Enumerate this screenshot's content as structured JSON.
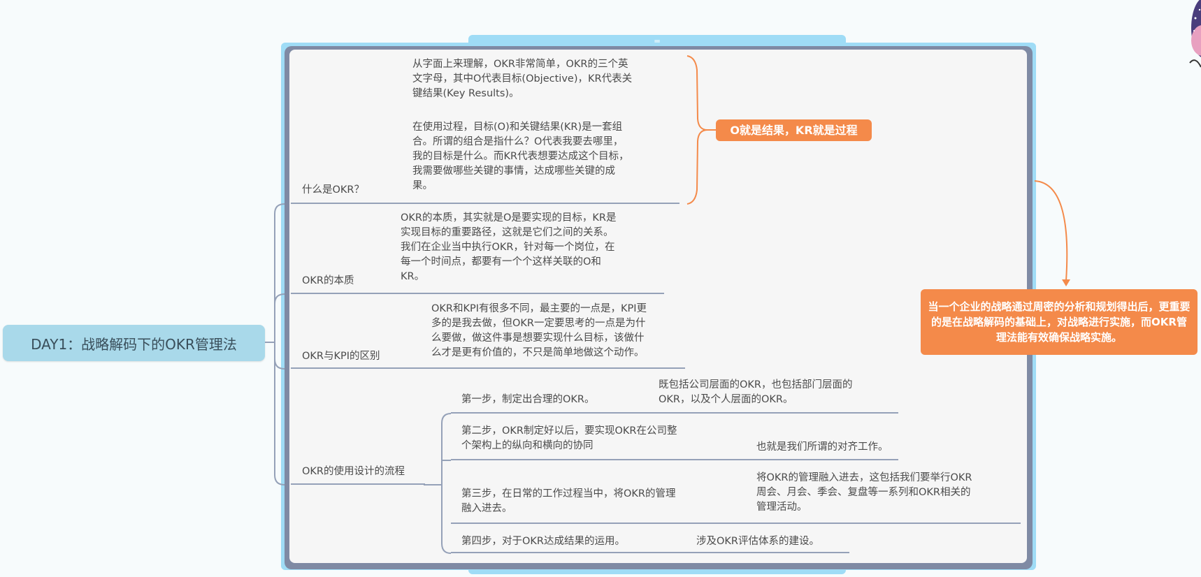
{
  "root": {
    "label": "DAY1：战略解码下的OKR管理法"
  },
  "frame": {
    "top_handle": "═",
    "bottom_handle": "═"
  },
  "branches": [
    {
      "label": "什么是OKR？",
      "detail_1": "从字面上来理解，OKR非常简单，OKR的三个英\n文字母，其中O代表目标(Objective)，KR代表关\n键结果(Key Results)。",
      "detail_2": "在使用过程，目标(O)和关键结果(KR)是一套组\n合。所谓的组合是指什么？O代表我要去哪里，\n我的目标是什么。而KR代表想要达成这个目标，\n我需要做哪些关键的事情，达成哪些关键的成\n果。"
    },
    {
      "label": "OKR的本质",
      "detail": "OKR的本质，其实就是O是要实现的目标，KR是\n实现目标的重要路径，这就是它们之间的关系。\n我们在企业当中执行OKR，针对每一个岗位，在\n每一个时间点，都要有一个个这样关联的O和\nKR。"
    },
    {
      "label": "OKR与KPI的区别",
      "detail": "OKR和KPI有很多不同，最主要的一点是，KPI更\n多的是我去做，但OKR一定要思考的一点是为什\n么要做，做这件事是想要实现什么目标，该做什\n么才是更有价值的，不只是简单地做这个动作。"
    },
    {
      "label": "OKR的使用设计的流程",
      "steps": [
        {
          "label": "第一步，制定出合理的OKR。",
          "detail": "既包括公司层面的OKR，也包括部门层面的\nOKR，以及个人层面的OKR。"
        },
        {
          "label": "第二步，OKR制定好以后，要实现OKR在公司整\n个架构上的纵向和横向的协同",
          "detail": "也就是我们所谓的对齐工作。"
        },
        {
          "label": "第三步，在日常的工作过程当中，将OKR的管理\n融入进去。",
          "detail": "将OKR的管理融入进去，这包括我们要举行OKR\n周会、月会、季会、复盘等一系列和OKR相关的\n管理活动。"
        },
        {
          "label": "第四步，对于OKR达成结果的运用。",
          "detail": "涉及OKR评估体系的建设。"
        }
      ]
    }
  ],
  "callouts": {
    "note": "O就是结果，KR就是过程",
    "summary": "当一个企业的战略通过周密的分析和规划得出后，更重要的是在战略解码的基础上，对战略进行实施，而OKR管理法能有效确保战略实施。"
  },
  "colors": {
    "root_fill": "#a9d9ea",
    "frame_fill": "#9fdcf6",
    "frame_dash": "#7f8aa4",
    "callout_fill": "#f48a4a",
    "connector": "#95a1b8"
  },
  "icons": {
    "avatar": "avatar-icon"
  }
}
